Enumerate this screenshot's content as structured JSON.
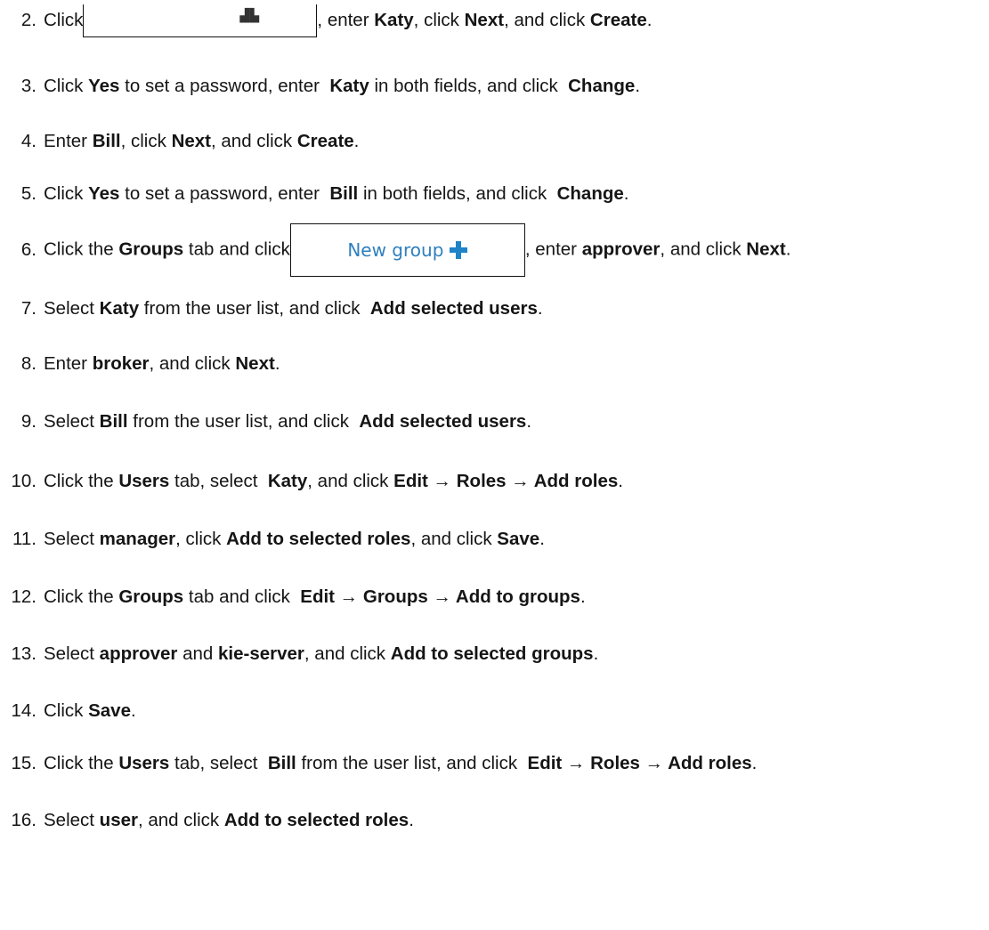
{
  "steps": [
    {
      "num": "2.",
      "parts": [
        {
          "t": "text",
          "v": "Click"
        },
        {
          "t": "button",
          "id": "new-user"
        },
        {
          "t": "text",
          "v": ", enter "
        },
        {
          "t": "val",
          "v": "Katy"
        },
        {
          "t": "text",
          "v": ", click "
        },
        {
          "t": "ui",
          "v": "Next"
        },
        {
          "t": "text",
          "v": ", and click "
        },
        {
          "t": "ui",
          "v": "Create"
        },
        {
          "t": "text",
          "v": "."
        }
      ]
    },
    {
      "num": "3.",
      "parts": [
        {
          "t": "text",
          "v": "Click "
        },
        {
          "t": "ui",
          "v": "Yes"
        },
        {
          "t": "text",
          "v": " to set a password, enter  "
        },
        {
          "t": "val",
          "v": "Katy"
        },
        {
          "t": "text",
          "v": " in both fields, and click  "
        },
        {
          "t": "ui",
          "v": "Change"
        },
        {
          "t": "text",
          "v": "."
        }
      ]
    },
    {
      "num": "4.",
      "parts": [
        {
          "t": "text",
          "v": "Enter "
        },
        {
          "t": "val",
          "v": "Bill"
        },
        {
          "t": "text",
          "v": ", click "
        },
        {
          "t": "ui",
          "v": "Next"
        },
        {
          "t": "text",
          "v": ", and click "
        },
        {
          "t": "ui",
          "v": "Create"
        },
        {
          "t": "text",
          "v": "."
        }
      ]
    },
    {
      "num": "5.",
      "parts": [
        {
          "t": "text",
          "v": "Click "
        },
        {
          "t": "ui",
          "v": "Yes"
        },
        {
          "t": "text",
          "v": " to set a password, enter  "
        },
        {
          "t": "val",
          "v": "Bill"
        },
        {
          "t": "text",
          "v": " in both fields, and click  "
        },
        {
          "t": "ui",
          "v": "Change"
        },
        {
          "t": "text",
          "v": "."
        }
      ]
    },
    {
      "num": "6.",
      "parts": [
        {
          "t": "text",
          "v": "Click the "
        },
        {
          "t": "ui",
          "v": "Groups"
        },
        {
          "t": "text",
          "v": " tab and click"
        },
        {
          "t": "button",
          "id": "new-group"
        },
        {
          "t": "text",
          "v": ", enter "
        },
        {
          "t": "val",
          "v": "approver"
        },
        {
          "t": "text",
          "v": ", and click "
        },
        {
          "t": "ui",
          "v": "Next"
        },
        {
          "t": "text",
          "v": "."
        }
      ]
    },
    {
      "num": "7.",
      "parts": [
        {
          "t": "text",
          "v": "Select "
        },
        {
          "t": "val",
          "v": "Katy"
        },
        {
          "t": "text",
          "v": " from the user list, and click  "
        },
        {
          "t": "ui",
          "v": "Add selected users"
        },
        {
          "t": "text",
          "v": "."
        }
      ]
    },
    {
      "num": "8.",
      "parts": [
        {
          "t": "text",
          "v": "Enter "
        },
        {
          "t": "val",
          "v": "broker"
        },
        {
          "t": "text",
          "v": ", and click "
        },
        {
          "t": "ui",
          "v": "Next"
        },
        {
          "t": "text",
          "v": "."
        }
      ]
    },
    {
      "num": "9.",
      "parts": [
        {
          "t": "text",
          "v": "Select "
        },
        {
          "t": "val",
          "v": "Bill"
        },
        {
          "t": "text",
          "v": " from the user list, and click  "
        },
        {
          "t": "ui",
          "v": "Add selected users"
        },
        {
          "t": "text",
          "v": "."
        }
      ]
    },
    {
      "num": "10.",
      "parts": [
        {
          "t": "text",
          "v": "Click the "
        },
        {
          "t": "ui",
          "v": "Users"
        },
        {
          "t": "text",
          "v": " tab, select  "
        },
        {
          "t": "ui",
          "v": "Katy"
        },
        {
          "t": "text",
          "v": ", and click "
        },
        {
          "t": "ui",
          "v": "Edit → Roles → Add roles"
        },
        {
          "t": "text",
          "v": "."
        }
      ]
    },
    {
      "num": "11.",
      "parts": [
        {
          "t": "text",
          "v": "Select "
        },
        {
          "t": "val",
          "v": "manager"
        },
        {
          "t": "text",
          "v": ", click "
        },
        {
          "t": "ui",
          "v": "Add to selected roles"
        },
        {
          "t": "text",
          "v": ", and click "
        },
        {
          "t": "ui",
          "v": "Save"
        },
        {
          "t": "text",
          "v": "."
        }
      ]
    },
    {
      "num": "12.",
      "parts": [
        {
          "t": "text",
          "v": "Click the "
        },
        {
          "t": "ui",
          "v": "Groups"
        },
        {
          "t": "text",
          "v": " tab and click  "
        },
        {
          "t": "ui",
          "v": "Edit → Groups → Add to groups"
        },
        {
          "t": "text",
          "v": "."
        }
      ]
    },
    {
      "num": "13.",
      "parts": [
        {
          "t": "text",
          "v": "Select "
        },
        {
          "t": "val",
          "v": "approver"
        },
        {
          "t": "text",
          "v": " and "
        },
        {
          "t": "val",
          "v": "kie-server"
        },
        {
          "t": "text",
          "v": ", and click "
        },
        {
          "t": "ui",
          "v": "Add to selected groups"
        },
        {
          "t": "text",
          "v": "."
        }
      ]
    },
    {
      "num": "14.",
      "parts": [
        {
          "t": "text",
          "v": "Click "
        },
        {
          "t": "ui",
          "v": "Save"
        },
        {
          "t": "text",
          "v": "."
        }
      ]
    },
    {
      "num": "15.",
      "parts": [
        {
          "t": "text",
          "v": "Click the "
        },
        {
          "t": "ui",
          "v": "Users"
        },
        {
          "t": "text",
          "v": " tab, select  "
        },
        {
          "t": "ui",
          "v": "Bill"
        },
        {
          "t": "text",
          "v": " from the user list, and click  "
        },
        {
          "t": "ui",
          "v": "Edit → Roles → Add roles"
        },
        {
          "t": "text",
          "v": "."
        }
      ]
    },
    {
      "num": "16.",
      "parts": [
        {
          "t": "text",
          "v": "Select "
        },
        {
          "t": "val",
          "v": "user"
        },
        {
          "t": "text",
          "v": ", and click "
        },
        {
          "t": "ui",
          "v": "Add to selected roles"
        },
        {
          "t": "text",
          "v": "."
        }
      ]
    }
  ],
  "buttons": {
    "new-user": {
      "label": "",
      "icon": "user-add-icon"
    },
    "new-group": {
      "label": "New group",
      "icon": "plus-icon",
      "color": "#2e7fbd"
    }
  }
}
